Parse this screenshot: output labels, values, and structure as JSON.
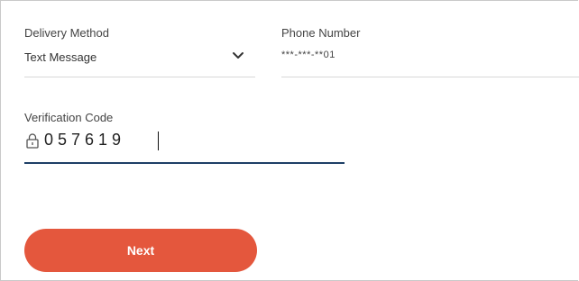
{
  "delivery": {
    "label": "Delivery Method",
    "selected": "Text Message",
    "icon": "chevron-down-icon"
  },
  "phone": {
    "label": "Phone Number",
    "value": "***-***-**01"
  },
  "verification": {
    "label": "Verification Code",
    "value": "057619",
    "icon": "lock-icon"
  },
  "actions": {
    "next_label": "Next"
  },
  "colors": {
    "accent_button": "#e4573d",
    "focus_underline": "#1e3f66",
    "divider": "#d8d8d8"
  }
}
